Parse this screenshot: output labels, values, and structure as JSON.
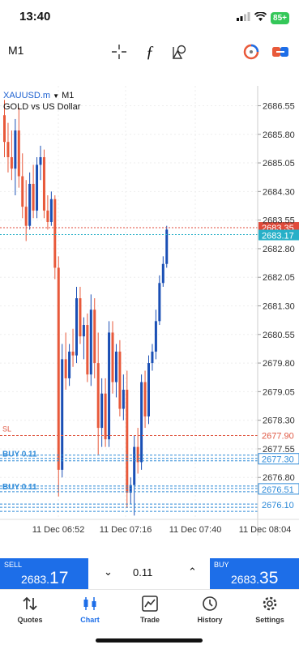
{
  "status_bar": {
    "time": "13:40",
    "battery": "85+"
  },
  "toolbar": {
    "timeframe": "M1"
  },
  "chart_header": {
    "symbol": "XAUUSD.m",
    "timeframe": "M1",
    "description": "GOLD vs US Dollar"
  },
  "chart_data": {
    "type": "candlestick",
    "y_ticks": [
      "2686.55",
      "2685.80",
      "2685.05",
      "2684.30",
      "2683.55",
      "2682.80",
      "2682.05",
      "2681.30",
      "2680.55",
      "2679.80",
      "2679.05",
      "2678.30",
      "2677.55",
      "2676.80"
    ],
    "x_ticks": [
      "11 Dec 06:52",
      "11 Dec 07:16",
      "11 Dec 07:40",
      "11 Dec 08:04"
    ],
    "ylim": [
      2675.7,
      2686.9
    ],
    "bid_label": "2683.35",
    "ask_label": "2683.17",
    "sl_label": "SL",
    "sl_price": "2677.90",
    "order_label_1": "BUY 0.11",
    "order_price_1": "2677.30",
    "order_label_2": "BUY 0.11",
    "order_price_2": "2676.51",
    "order_price_3": "2676.10",
    "colors": {
      "up": "#1a4fb5",
      "down": "#e8593a",
      "sl": "#e05a45",
      "order": "#2d8ad8",
      "bid": "#e04a3a",
      "ask": "#27b0c8"
    }
  },
  "trade_bar": {
    "sell_label": "SELL",
    "sell_price_main": "2683.",
    "sell_price_big": "17",
    "volume": "0.11",
    "buy_label": "BUY",
    "buy_price_main": "2683.",
    "buy_price_big": "35"
  },
  "nav": {
    "quotes": "Quotes",
    "chart": "Chart",
    "trade": "Trade",
    "history": "History",
    "settings": "Settings"
  }
}
